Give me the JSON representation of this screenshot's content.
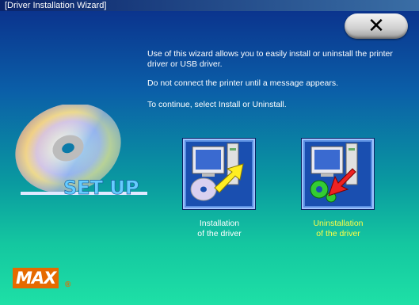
{
  "window": {
    "title": "[Driver Installation Wizard]"
  },
  "close_button": {
    "glyph": "✕"
  },
  "intro": {
    "line1": "Use of this wizard allows you to easily install or uninstall the printer driver or USB driver.",
    "line2": "Do not connect the printer until a message appears.",
    "line3": "To continue, select Install or Uninstall."
  },
  "artwork": {
    "setup_text": "SET UP"
  },
  "install": {
    "label_line1": "Installation",
    "label_line2": "of the driver"
  },
  "uninstall": {
    "label_line1": "Uninstallation",
    "label_line2": "of the driver"
  },
  "logo": {
    "text": "MAX",
    "mark": "®",
    "color": "#e66a00"
  },
  "colors": {
    "highlight_label": "#ffff44",
    "normal_label": "#ffffff"
  }
}
